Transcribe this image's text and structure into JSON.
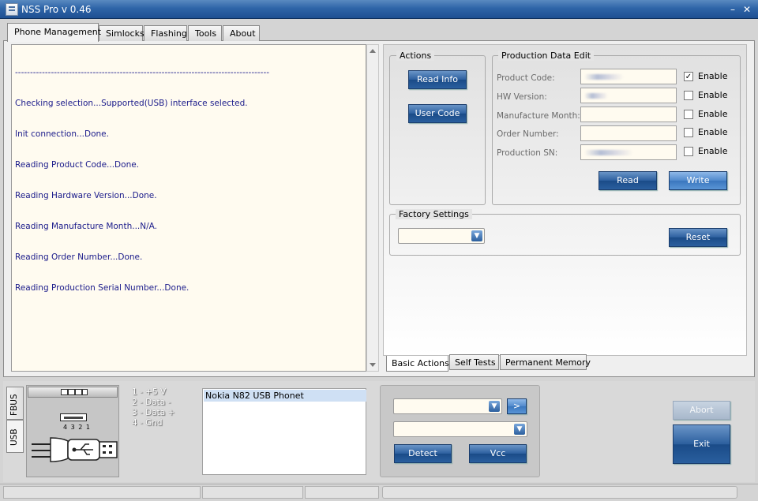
{
  "window": {
    "title": "NSS Pro v 0.46",
    "min_glyph": "–",
    "close_glyph": "✕"
  },
  "tabs": [
    {
      "label": "Phone Management",
      "active": true
    },
    {
      "label": "Simlocks"
    },
    {
      "label": "Flashing"
    },
    {
      "label": "Tools"
    },
    {
      "label": "About"
    }
  ],
  "log": {
    "lines": [
      "-------------------------------------------------------------------------------------",
      "Checking selection...Supported(USB) interface selected.",
      "Init connection...Done.",
      "Reading Product Code...Done.",
      "Reading Hardware Version...Done.",
      "Reading Manufacture Month...N/A.",
      "Reading Order Number...Done.",
      "Reading Production Serial Number...Done."
    ]
  },
  "actions": {
    "title": "Actions",
    "read_info": "Read Info",
    "user_code": "User Code"
  },
  "production": {
    "title": "Production Data Edit",
    "fields": [
      {
        "label": "Product Code:",
        "enable": "Enable",
        "checked": true
      },
      {
        "label": "HW Version:",
        "enable": "Enable",
        "checked": false
      },
      {
        "label": "Manufacture Month:",
        "enable": "Enable",
        "checked": false
      },
      {
        "label": "Order Number:",
        "enable": "Enable",
        "checked": false
      },
      {
        "label": "Production SN:",
        "enable": "Enable",
        "checked": false
      }
    ],
    "read": "Read",
    "write": "Write"
  },
  "factory": {
    "title": "Factory Settings",
    "reset": "Reset"
  },
  "bottom_tabs": [
    {
      "label": "Basic Actions",
      "active": true
    },
    {
      "label": "Self Tests"
    },
    {
      "label": "Permanent Memory"
    }
  ],
  "side_tabs": {
    "fbus": "FBUS",
    "usb": "USB"
  },
  "usb_pins": {
    "header": "4 3 2 1",
    "list": "1 - +5 V\n2 - Data -\n3 - Data +\n4 - Gnd"
  },
  "devices": {
    "items": [
      "Nokia N82 USB Phonet"
    ]
  },
  "connection": {
    "go": ">",
    "detect": "Detect",
    "vcc": "Vcc"
  },
  "controls": {
    "abort": "Abort",
    "exit": "Exit"
  },
  "icons": [
    "app-icon",
    "minimize-icon",
    "close-icon",
    "usb-port-icon",
    "usb-plug-icon",
    "dropdown-arrow-icon"
  ],
  "colors": {
    "titlebar": "#2f65a8",
    "button": "#2c5f9e",
    "log_text": "#1a1a8a",
    "log_bg": "#fffbf0"
  }
}
